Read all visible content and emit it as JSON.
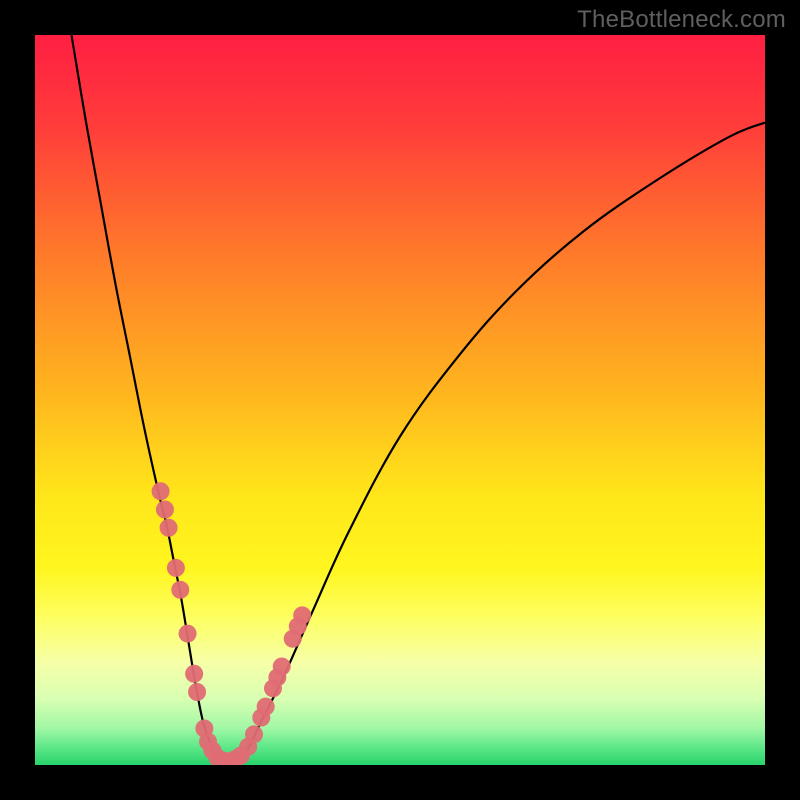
{
  "watermark": "TheBottleneck.com",
  "colors": {
    "frame": "#000000",
    "curve": "#000000",
    "marker_fill": "#e06c74",
    "marker_stroke": "#e06c74",
    "gradient_stops": [
      {
        "offset": 0.0,
        "color": "#ff1f42"
      },
      {
        "offset": 0.12,
        "color": "#ff3b3b"
      },
      {
        "offset": 0.3,
        "color": "#ff7a2a"
      },
      {
        "offset": 0.48,
        "color": "#ffb21f"
      },
      {
        "offset": 0.63,
        "color": "#ffe61a"
      },
      {
        "offset": 0.73,
        "color": "#fff61f"
      },
      {
        "offset": 0.8,
        "color": "#fdff63"
      },
      {
        "offset": 0.86,
        "color": "#f6ffa8"
      },
      {
        "offset": 0.91,
        "color": "#d8ffb2"
      },
      {
        "offset": 0.95,
        "color": "#a0f7a5"
      },
      {
        "offset": 0.975,
        "color": "#5fe889"
      },
      {
        "offset": 1.0,
        "color": "#28d36b"
      }
    ]
  },
  "chart_data": {
    "type": "line",
    "title": "",
    "xlabel": "",
    "ylabel": "",
    "xlim": [
      0,
      100
    ],
    "ylim": [
      0,
      100
    ],
    "grid": false,
    "series": [
      {
        "name": "bottleneck-curve",
        "x": [
          5,
          7,
          9,
          11,
          13,
          15,
          17,
          18,
          19,
          20,
          21,
          22,
          23,
          24,
          25,
          27,
          29,
          31,
          34,
          38,
          43,
          50,
          58,
          66,
          75,
          85,
          95,
          100
        ],
        "y": [
          100,
          88,
          77,
          66,
          56,
          46,
          37,
          33,
          28,
          23,
          17,
          11,
          6,
          3,
          1,
          0.5,
          2,
          6,
          12,
          21,
          32,
          45,
          56,
          65,
          73,
          80,
          86,
          88
        ]
      }
    ],
    "marker_clusters": [
      {
        "name": "left-arm-markers",
        "points": [
          {
            "x": 17.2,
            "y": 37.5
          },
          {
            "x": 17.8,
            "y": 35.0
          },
          {
            "x": 18.3,
            "y": 32.5
          },
          {
            "x": 19.3,
            "y": 27.0
          },
          {
            "x": 19.9,
            "y": 24.0
          },
          {
            "x": 20.9,
            "y": 18.0
          },
          {
            "x": 21.8,
            "y": 12.5
          },
          {
            "x": 22.2,
            "y": 10.0
          },
          {
            "x": 23.2,
            "y": 5.0
          },
          {
            "x": 23.7,
            "y": 3.2
          },
          {
            "x": 24.3,
            "y": 2.0
          }
        ]
      },
      {
        "name": "valley-markers",
        "points": [
          {
            "x": 25.0,
            "y": 1.0
          },
          {
            "x": 25.8,
            "y": 0.6
          },
          {
            "x": 26.6,
            "y": 0.5
          },
          {
            "x": 27.4,
            "y": 0.8
          },
          {
            "x": 28.2,
            "y": 1.3
          }
        ]
      },
      {
        "name": "right-arm-markers",
        "points": [
          {
            "x": 29.2,
            "y": 2.5
          },
          {
            "x": 30.0,
            "y": 4.2
          },
          {
            "x": 31.0,
            "y": 6.5
          },
          {
            "x": 31.6,
            "y": 8.0
          },
          {
            "x": 32.6,
            "y": 10.5
          },
          {
            "x": 33.2,
            "y": 12.0
          },
          {
            "x": 33.8,
            "y": 13.5
          },
          {
            "x": 35.3,
            "y": 17.3
          },
          {
            "x": 36.0,
            "y": 19.0
          },
          {
            "x": 36.6,
            "y": 20.5
          }
        ]
      }
    ]
  }
}
